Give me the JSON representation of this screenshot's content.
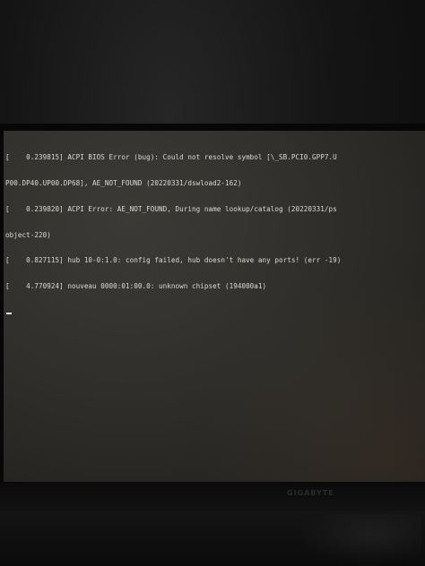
{
  "console": {
    "lines": [
      "[    0.239815] ACPI BIOS Error (bug): Could not resolve symbol [\\_SB.PCI0.GPP7.U",
      "P00.DP40.UP00.DP68], AE_NOT_FOUND (20220331/dswload2-162)",
      "[    0.239820] ACPI Error: AE_NOT_FOUND, During name lookup/catalog (20220331/ps",
      "object-220)",
      "[    0.827115] hub 10-0:1.0: config failed, hub doesn't have any ports! (err -19)",
      "[    4.770924] nouveau 0000:01:00.0: unknown chipset (194000a1)"
    ]
  },
  "monitor": {
    "brand": "GIGABYTE"
  },
  "colors": {
    "screen_background": "#34332f",
    "console_text": "#dcdcd6",
    "bezel": "#070707"
  }
}
